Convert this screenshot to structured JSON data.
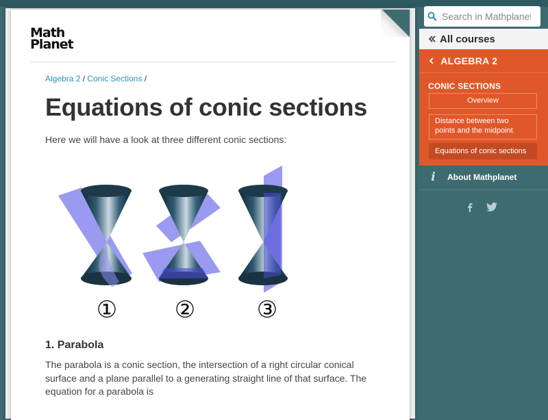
{
  "header": {
    "logo_line1": "Math",
    "logo_line2": "Planet"
  },
  "breadcrumb": {
    "item1": "Algebra 2",
    "sep1": "/",
    "item2": "Conic Sections",
    "sep2": "/"
  },
  "page": {
    "title": "Equations of conic sections",
    "intro": "Here we will have a look at three different conic sections:",
    "figure_labels": [
      "①",
      "②",
      "③"
    ],
    "section_heading": "1. Parabola",
    "paragraph": "The parabola is a conic section, the intersection of a right circular conical surface and a plane parallel to a generating straight line of that surface. The equation for a parabola is"
  },
  "sidebar": {
    "search_placeholder": "Search in Mathplanet",
    "all_courses": "All courses",
    "course": "ALGEBRA 2",
    "section": "CONIC SECTIONS",
    "items": [
      "Overview",
      "Distance between two points and the midpoint",
      "Equations of conic sections"
    ],
    "about": "About Mathplanet",
    "about_icon": "i",
    "social": [
      "facebook-icon",
      "twitter-icon"
    ]
  },
  "colors": {
    "sidebar_bg": "#3d6b70",
    "accent_orange": "#e0582a",
    "active_item": "#c34a22",
    "link": "#2e8fb0",
    "plane": "#8f8ff0"
  }
}
